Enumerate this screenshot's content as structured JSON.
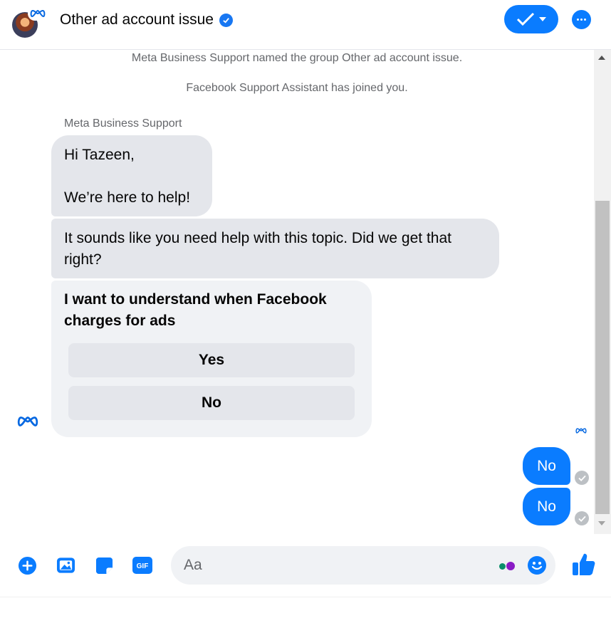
{
  "header": {
    "title": "Other ad account issue",
    "verified_icon": "verified-badge-icon",
    "done_button_icon": "checkmark-icon",
    "more_button_icon": "more-options-icon"
  },
  "chat": {
    "system_messages": [
      "Meta Business Support named the group Other ad account issue.",
      "Facebook Support Assistant has joined you."
    ],
    "sender_name": "Meta Business Support",
    "incoming_messages": [
      {
        "lines": [
          "Hi Tazeen,",
          "",
          "We’re here to help!"
        ]
      },
      {
        "text": "It sounds like you need help with this topic. Did we get that right?"
      }
    ],
    "card": {
      "question": "I want to understand when Facebook charges for ads",
      "options": [
        "Yes",
        "No"
      ]
    },
    "outgoing_messages": [
      "No",
      "No"
    ]
  },
  "composer": {
    "placeholder": "Aa",
    "icons": [
      "add-icon",
      "photo-icon",
      "sticker-icon",
      "gif-icon",
      "emoji-icon",
      "like-icon"
    ],
    "gif_label": "GIF"
  },
  "colors": {
    "accent": "#0a7cff",
    "incoming_bubble": "#e4e6eb",
    "card_bg": "#f0f2f5",
    "meta_blue": "#0668e1"
  }
}
